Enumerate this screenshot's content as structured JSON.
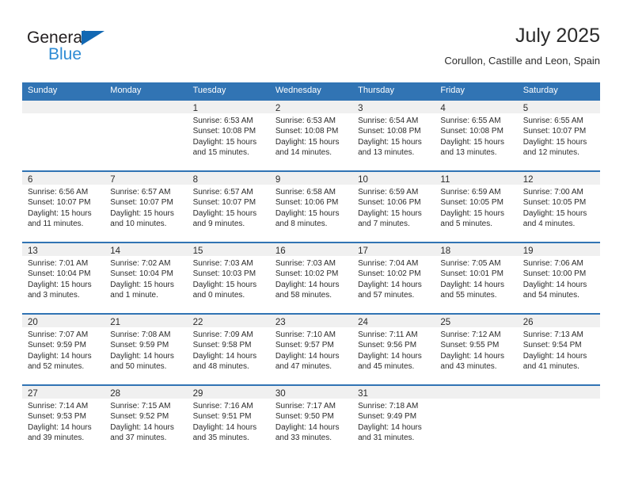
{
  "brand": {
    "name_dark": "General",
    "name_blue": "Blue",
    "accent_color": "#1268b3",
    "accent_light": "#2e8bd4"
  },
  "header": {
    "title": "July 2025",
    "subtitle": "Corullon, Castille and Leon, Spain"
  },
  "theme": {
    "header_blue": "#3174b4",
    "band_gray": "#f0f0f0",
    "text": "#2b2b2b"
  },
  "weekdays": [
    "Sunday",
    "Monday",
    "Tuesday",
    "Wednesday",
    "Thursday",
    "Friday",
    "Saturday"
  ],
  "weeks": [
    [
      {
        "day": "",
        "sunrise": "",
        "sunset": "",
        "daylight_1": "",
        "daylight_2": ""
      },
      {
        "day": "",
        "sunrise": "",
        "sunset": "",
        "daylight_1": "",
        "daylight_2": ""
      },
      {
        "day": "1",
        "sunrise": "Sunrise: 6:53 AM",
        "sunset": "Sunset: 10:08 PM",
        "daylight_1": "Daylight: 15 hours",
        "daylight_2": "and 15 minutes."
      },
      {
        "day": "2",
        "sunrise": "Sunrise: 6:53 AM",
        "sunset": "Sunset: 10:08 PM",
        "daylight_1": "Daylight: 15 hours",
        "daylight_2": "and 14 minutes."
      },
      {
        "day": "3",
        "sunrise": "Sunrise: 6:54 AM",
        "sunset": "Sunset: 10:08 PM",
        "daylight_1": "Daylight: 15 hours",
        "daylight_2": "and 13 minutes."
      },
      {
        "day": "4",
        "sunrise": "Sunrise: 6:55 AM",
        "sunset": "Sunset: 10:08 PM",
        "daylight_1": "Daylight: 15 hours",
        "daylight_2": "and 13 minutes."
      },
      {
        "day": "5",
        "sunrise": "Sunrise: 6:55 AM",
        "sunset": "Sunset: 10:07 PM",
        "daylight_1": "Daylight: 15 hours",
        "daylight_2": "and 12 minutes."
      }
    ],
    [
      {
        "day": "6",
        "sunrise": "Sunrise: 6:56 AM",
        "sunset": "Sunset: 10:07 PM",
        "daylight_1": "Daylight: 15 hours",
        "daylight_2": "and 11 minutes."
      },
      {
        "day": "7",
        "sunrise": "Sunrise: 6:57 AM",
        "sunset": "Sunset: 10:07 PM",
        "daylight_1": "Daylight: 15 hours",
        "daylight_2": "and 10 minutes."
      },
      {
        "day": "8",
        "sunrise": "Sunrise: 6:57 AM",
        "sunset": "Sunset: 10:07 PM",
        "daylight_1": "Daylight: 15 hours",
        "daylight_2": "and 9 minutes."
      },
      {
        "day": "9",
        "sunrise": "Sunrise: 6:58 AM",
        "sunset": "Sunset: 10:06 PM",
        "daylight_1": "Daylight: 15 hours",
        "daylight_2": "and 8 minutes."
      },
      {
        "day": "10",
        "sunrise": "Sunrise: 6:59 AM",
        "sunset": "Sunset: 10:06 PM",
        "daylight_1": "Daylight: 15 hours",
        "daylight_2": "and 7 minutes."
      },
      {
        "day": "11",
        "sunrise": "Sunrise: 6:59 AM",
        "sunset": "Sunset: 10:05 PM",
        "daylight_1": "Daylight: 15 hours",
        "daylight_2": "and 5 minutes."
      },
      {
        "day": "12",
        "sunrise": "Sunrise: 7:00 AM",
        "sunset": "Sunset: 10:05 PM",
        "daylight_1": "Daylight: 15 hours",
        "daylight_2": "and 4 minutes."
      }
    ],
    [
      {
        "day": "13",
        "sunrise": "Sunrise: 7:01 AM",
        "sunset": "Sunset: 10:04 PM",
        "daylight_1": "Daylight: 15 hours",
        "daylight_2": "and 3 minutes."
      },
      {
        "day": "14",
        "sunrise": "Sunrise: 7:02 AM",
        "sunset": "Sunset: 10:04 PM",
        "daylight_1": "Daylight: 15 hours",
        "daylight_2": "and 1 minute."
      },
      {
        "day": "15",
        "sunrise": "Sunrise: 7:03 AM",
        "sunset": "Sunset: 10:03 PM",
        "daylight_1": "Daylight: 15 hours",
        "daylight_2": "and 0 minutes."
      },
      {
        "day": "16",
        "sunrise": "Sunrise: 7:03 AM",
        "sunset": "Sunset: 10:02 PM",
        "daylight_1": "Daylight: 14 hours",
        "daylight_2": "and 58 minutes."
      },
      {
        "day": "17",
        "sunrise": "Sunrise: 7:04 AM",
        "sunset": "Sunset: 10:02 PM",
        "daylight_1": "Daylight: 14 hours",
        "daylight_2": "and 57 minutes."
      },
      {
        "day": "18",
        "sunrise": "Sunrise: 7:05 AM",
        "sunset": "Sunset: 10:01 PM",
        "daylight_1": "Daylight: 14 hours",
        "daylight_2": "and 55 minutes."
      },
      {
        "day": "19",
        "sunrise": "Sunrise: 7:06 AM",
        "sunset": "Sunset: 10:00 PM",
        "daylight_1": "Daylight: 14 hours",
        "daylight_2": "and 54 minutes."
      }
    ],
    [
      {
        "day": "20",
        "sunrise": "Sunrise: 7:07 AM",
        "sunset": "Sunset: 9:59 PM",
        "daylight_1": "Daylight: 14 hours",
        "daylight_2": "and 52 minutes."
      },
      {
        "day": "21",
        "sunrise": "Sunrise: 7:08 AM",
        "sunset": "Sunset: 9:59 PM",
        "daylight_1": "Daylight: 14 hours",
        "daylight_2": "and 50 minutes."
      },
      {
        "day": "22",
        "sunrise": "Sunrise: 7:09 AM",
        "sunset": "Sunset: 9:58 PM",
        "daylight_1": "Daylight: 14 hours",
        "daylight_2": "and 48 minutes."
      },
      {
        "day": "23",
        "sunrise": "Sunrise: 7:10 AM",
        "sunset": "Sunset: 9:57 PM",
        "daylight_1": "Daylight: 14 hours",
        "daylight_2": "and 47 minutes."
      },
      {
        "day": "24",
        "sunrise": "Sunrise: 7:11 AM",
        "sunset": "Sunset: 9:56 PM",
        "daylight_1": "Daylight: 14 hours",
        "daylight_2": "and 45 minutes."
      },
      {
        "day": "25",
        "sunrise": "Sunrise: 7:12 AM",
        "sunset": "Sunset: 9:55 PM",
        "daylight_1": "Daylight: 14 hours",
        "daylight_2": "and 43 minutes."
      },
      {
        "day": "26",
        "sunrise": "Sunrise: 7:13 AM",
        "sunset": "Sunset: 9:54 PM",
        "daylight_1": "Daylight: 14 hours",
        "daylight_2": "and 41 minutes."
      }
    ],
    [
      {
        "day": "27",
        "sunrise": "Sunrise: 7:14 AM",
        "sunset": "Sunset: 9:53 PM",
        "daylight_1": "Daylight: 14 hours",
        "daylight_2": "and 39 minutes."
      },
      {
        "day": "28",
        "sunrise": "Sunrise: 7:15 AM",
        "sunset": "Sunset: 9:52 PM",
        "daylight_1": "Daylight: 14 hours",
        "daylight_2": "and 37 minutes."
      },
      {
        "day": "29",
        "sunrise": "Sunrise: 7:16 AM",
        "sunset": "Sunset: 9:51 PM",
        "daylight_1": "Daylight: 14 hours",
        "daylight_2": "and 35 minutes."
      },
      {
        "day": "30",
        "sunrise": "Sunrise: 7:17 AM",
        "sunset": "Sunset: 9:50 PM",
        "daylight_1": "Daylight: 14 hours",
        "daylight_2": "and 33 minutes."
      },
      {
        "day": "31",
        "sunrise": "Sunrise: 7:18 AM",
        "sunset": "Sunset: 9:49 PM",
        "daylight_1": "Daylight: 14 hours",
        "daylight_2": "and 31 minutes."
      },
      {
        "day": "",
        "sunrise": "",
        "sunset": "",
        "daylight_1": "",
        "daylight_2": ""
      },
      {
        "day": "",
        "sunrise": "",
        "sunset": "",
        "daylight_1": "",
        "daylight_2": ""
      }
    ]
  ]
}
